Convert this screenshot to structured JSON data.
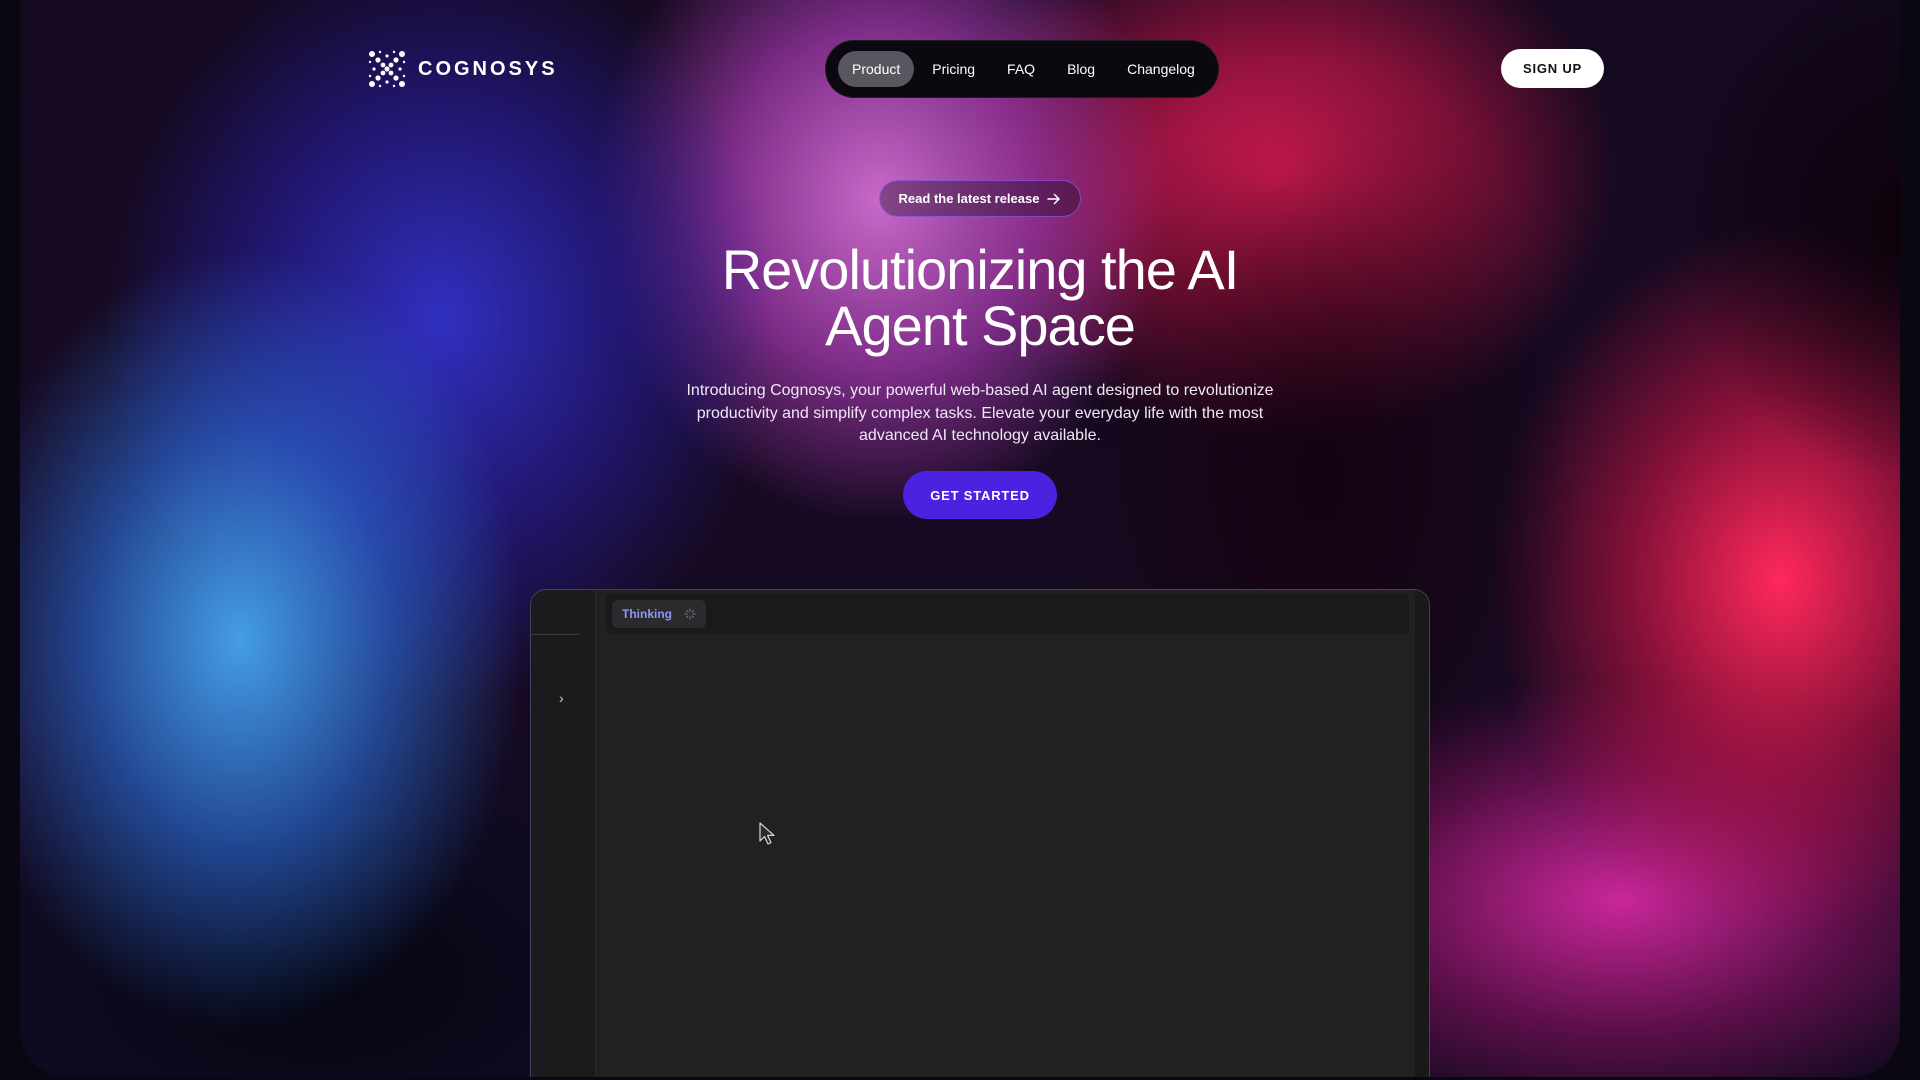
{
  "brand": {
    "name": "COGNOSYS",
    "logo_icon": "sparkle-x-icon"
  },
  "nav": {
    "items": [
      {
        "label": "Product",
        "active": true
      },
      {
        "label": "Pricing",
        "active": false
      },
      {
        "label": "FAQ",
        "active": false
      },
      {
        "label": "Blog",
        "active": false
      },
      {
        "label": "Changelog",
        "active": false
      }
    ]
  },
  "header": {
    "signup_label": "SIGN UP"
  },
  "hero": {
    "release_label": "Read the latest release",
    "title_line1": "Revolutionizing the AI",
    "title_line2": "Agent Space",
    "subtitle": "Introducing Cognosys, your powerful web-based AI agent designed to revolutionize productivity and simplify complex tasks. Elevate your everyday life with the most advanced AI technology available.",
    "cta_label": "GET STARTED"
  },
  "app": {
    "status_label": "Thinking",
    "sidebar_toggle": "›"
  },
  "colors": {
    "cta": "#4b22e0",
    "thinking_text": "#8f95f5",
    "nav_active": "#5a565f"
  }
}
